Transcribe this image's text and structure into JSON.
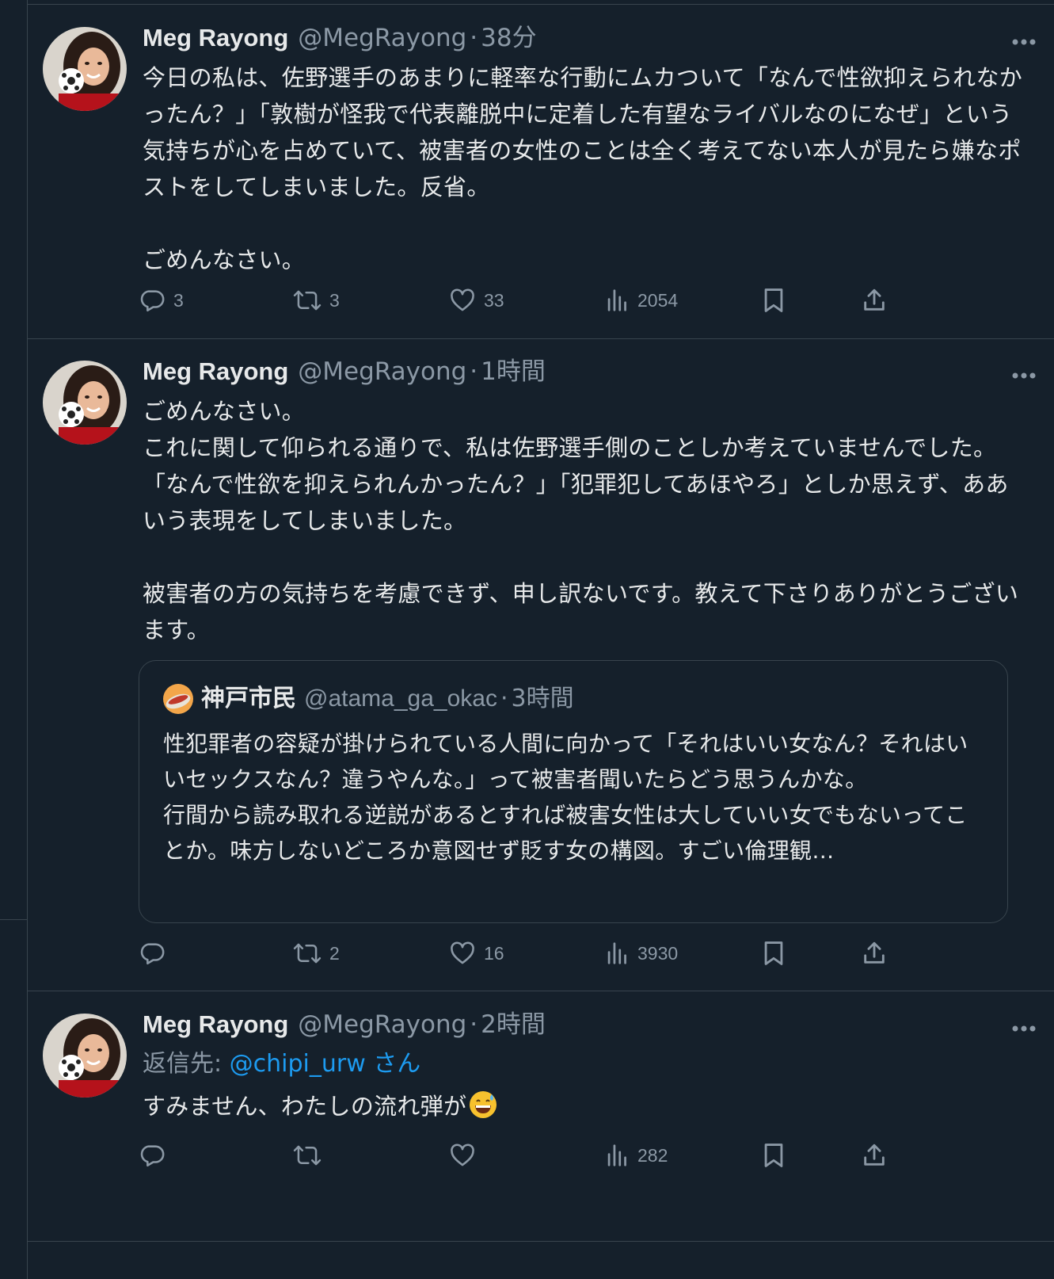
{
  "colors": {
    "background": "#15202b",
    "divider": "#38444d",
    "text_primary": "#e7e9ea",
    "text_secondary": "#8b98a5",
    "accent": "#1d9bf0"
  },
  "tweets": [
    {
      "name": "Meg Rayong",
      "handle": "@MegRayong",
      "separator": "·",
      "time": "38分",
      "text": "今日の私は、佐野選手のあまりに軽率な行動にムカついて「なんで性欲抑えられなかったん？」「敦樹が怪我で代表離脱中に定着した有望なライバルなのになぜ」という気持ちが心を占めていて、被害者の女性のことは全く考えてない本人が見たら嫌なポストをしてしまいました。反省。\n\nごめんなさい。",
      "actions": {
        "replies": "3",
        "retweets": "3",
        "likes": "33",
        "views": "2054"
      }
    },
    {
      "name": "Meg Rayong",
      "handle": "@MegRayong",
      "separator": "·",
      "time": "1時間",
      "text": "ごめんなさい。\nこれに関して仰られる通りで、私は佐野選手側のことしか考えていませんでした。「なんで性欲を抑えられんかったん？」「犯罪犯してあほやろ」としか思えず、ああいう表現をしてしまいました。\n\n被害者の方の気持ちを考慮できず、申し訳ないです。教えて下さりありがとうございます。",
      "quote": {
        "name": "神戸市民",
        "handle": "@atama_ga_okac",
        "separator": "·",
        "time": "3時間",
        "text": "性犯罪者の容疑が掛けられている人間に向かって「それはいい女なん？それはいいセックスなん？違うやんな。」って被害者聞いたらどう思うんかな。\n行間から読み取れる逆説があるとすれば被害女性は大していい女でもないってことか。味方しないどころか意図せず貶す女の構図。すごい倫理観…"
      },
      "actions": {
        "replies": "",
        "retweets": "2",
        "likes": "16",
        "views": "3930"
      }
    },
    {
      "name": "Meg Rayong",
      "handle": "@MegRayong",
      "separator": "·",
      "time": "2時間",
      "reply_label": "返信先: ",
      "reply_mention": "@chipi_urw",
      "reply_suffix": " さん",
      "text": "すみません、わたしの流れ弾が",
      "emoji": "grinning-sweat-emoji",
      "actions": {
        "replies": "",
        "retweets": "",
        "likes": "",
        "views": "282"
      }
    }
  ]
}
